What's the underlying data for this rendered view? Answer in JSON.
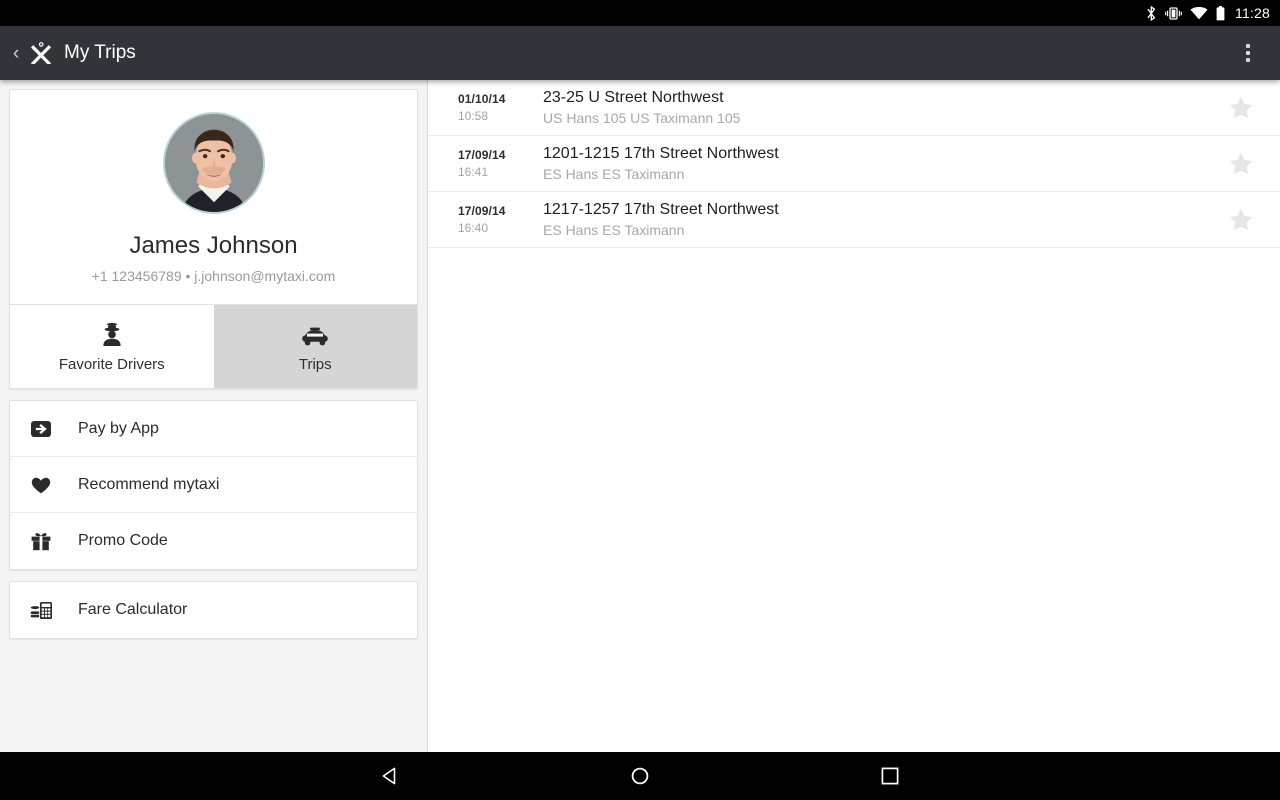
{
  "status_bar": {
    "icons": [
      "bluetooth-icon",
      "vibrate-icon",
      "wifi-icon",
      "battery-icon"
    ],
    "clock": "11:28"
  },
  "app_bar": {
    "back_label": "‹",
    "brand_icon": "mytaxi-x-logo-icon",
    "title": "My Trips",
    "overflow_icon": "overflow-menu-icon"
  },
  "profile": {
    "avatar_icon": "user-avatar-photo",
    "name": "James Johnson",
    "contact": "+1 123456789 • j.johnson@mytaxi.com"
  },
  "tabs": [
    {
      "label": "Favorite Drivers",
      "icon": "driver-icon",
      "active": false
    },
    {
      "label": "Trips",
      "icon": "taxi-icon",
      "active": true
    }
  ],
  "menu_groups": [
    {
      "items": [
        {
          "label": "Pay by App",
          "icon": "pay-by-app-icon"
        },
        {
          "label": "Recommend mytaxi",
          "icon": "heart-icon"
        },
        {
          "label": "Promo Code",
          "icon": "gift-icon"
        }
      ]
    },
    {
      "items": [
        {
          "label": "Fare Calculator",
          "icon": "calculator-icon"
        }
      ]
    }
  ],
  "trips": [
    {
      "date": "01/10/14",
      "time": "10:58",
      "address": "23-25 U Street Northwest",
      "driver": "US Hans 105 US Taximann 105",
      "favorite": false,
      "star_icon": "star-icon"
    },
    {
      "date": "17/09/14",
      "time": "16:41",
      "address": "1201-1215 17th Street Northwest",
      "driver": "ES Hans ES Taximann",
      "favorite": false,
      "star_icon": "star-icon"
    },
    {
      "date": "17/09/14",
      "time": "16:40",
      "address": "1217-1257 17th Street Northwest",
      "driver": "ES Hans ES Taximann",
      "favorite": false,
      "star_icon": "star-icon"
    }
  ],
  "nav_bar": {
    "back": "back-nav-icon",
    "home": "home-nav-icon",
    "recents": "recents-nav-icon"
  },
  "colors": {
    "app_bar": "#31353a",
    "left_pane_bg": "#f4f4f4",
    "active_tab_bg": "#d5d5d5",
    "avatar_ring": "#b9d3dd",
    "star": "#e6e6e6"
  }
}
